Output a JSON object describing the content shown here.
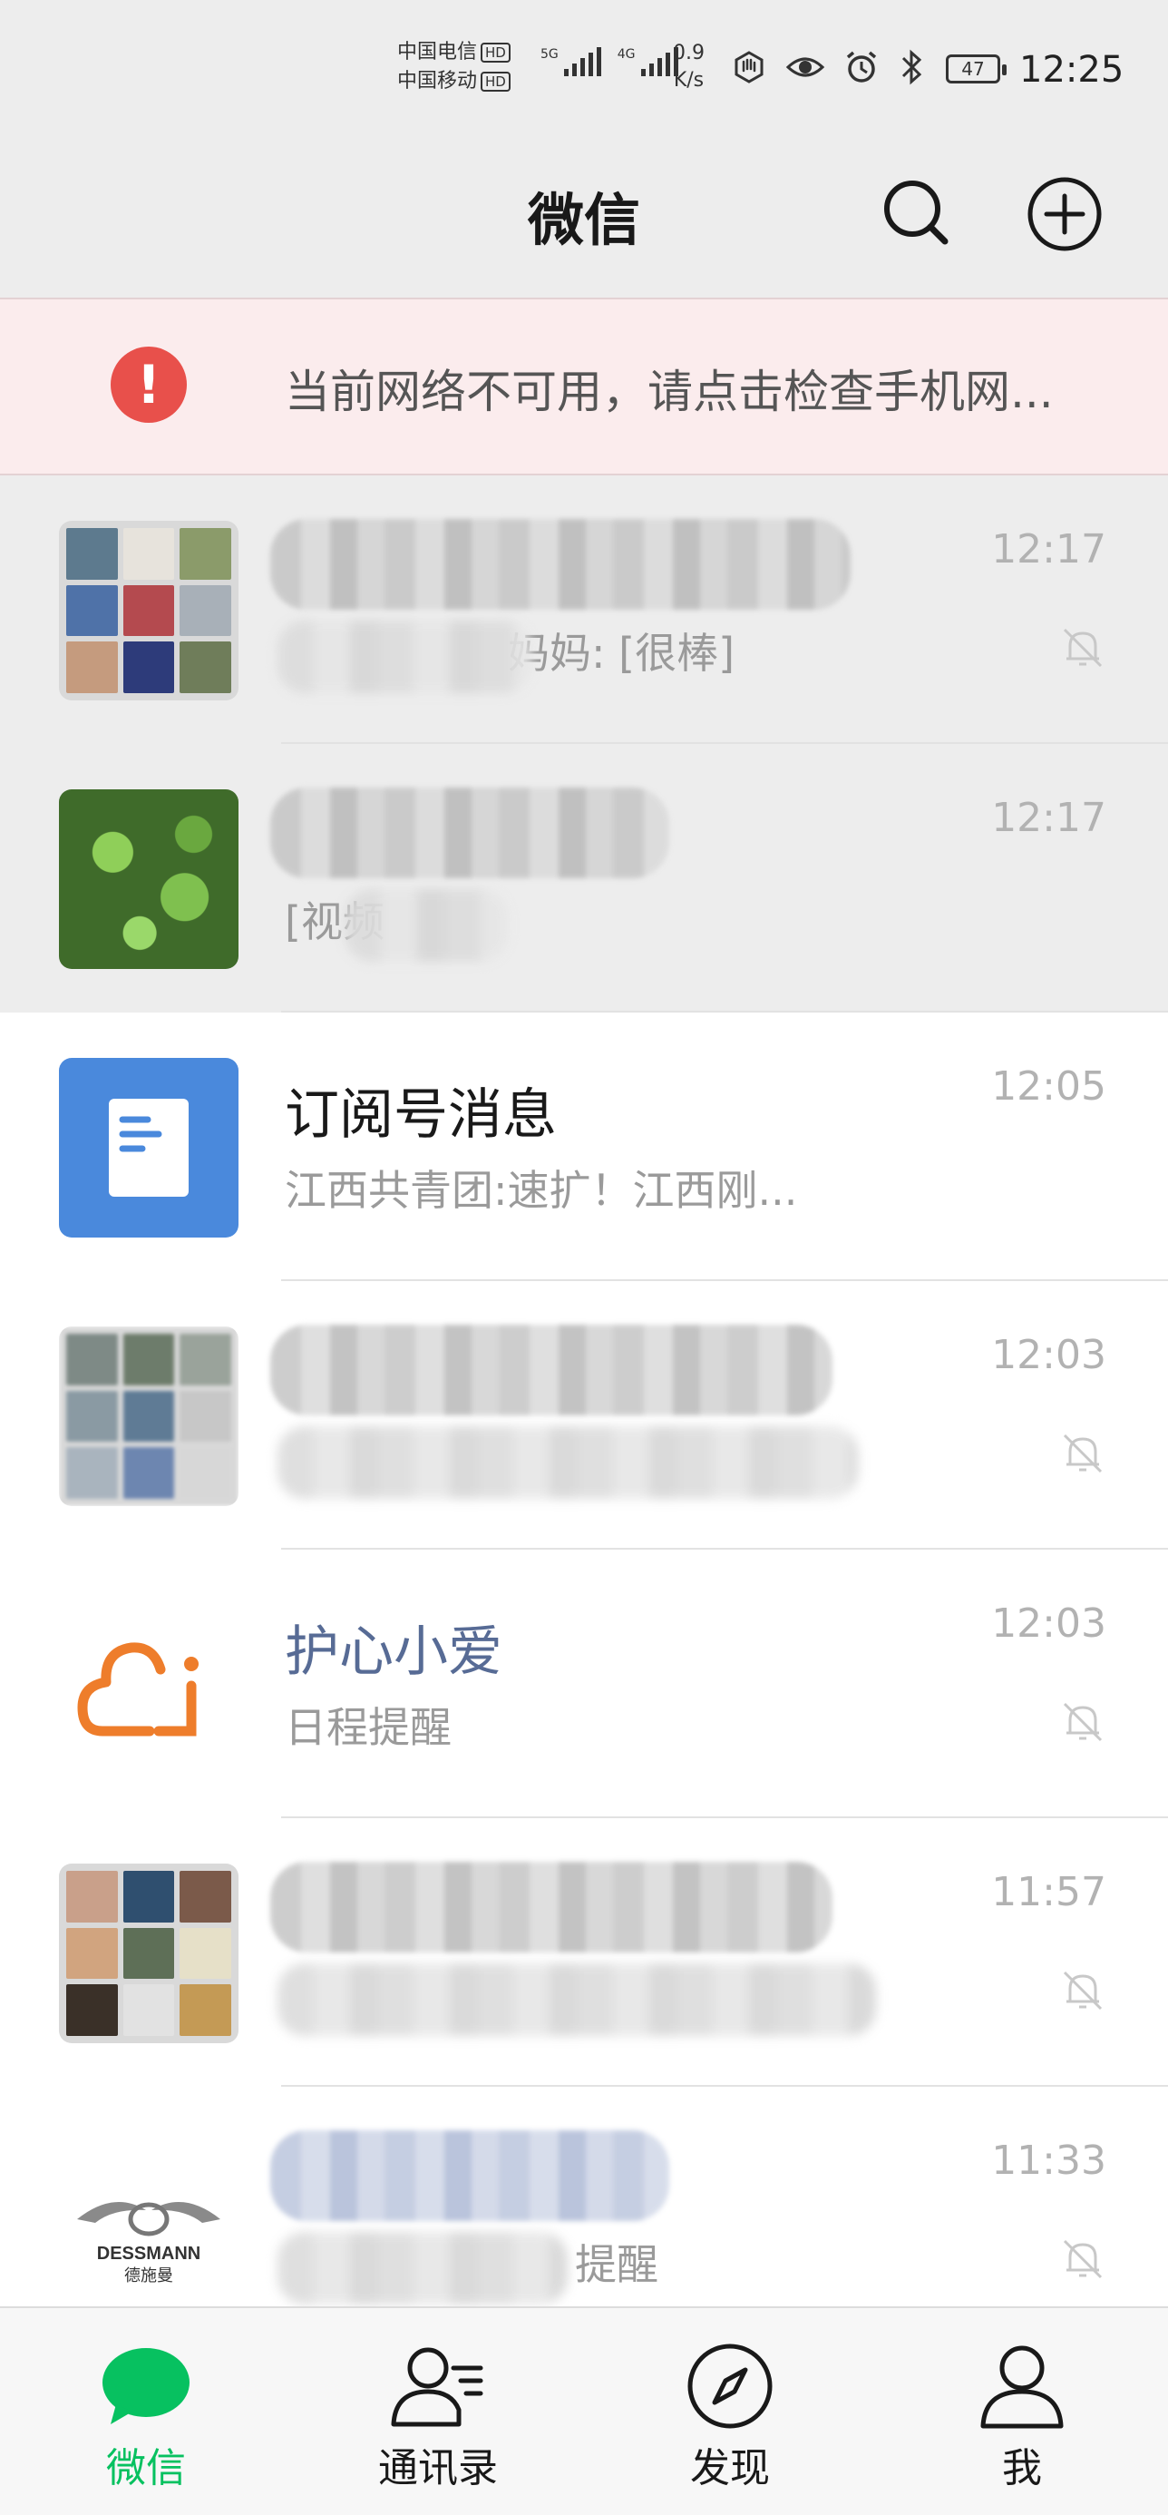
{
  "status_bar": {
    "carrier1": "中国电信",
    "carrier2": "中国移动",
    "hd_badge": "HD",
    "net1_label": "5G",
    "net2_label": "4G",
    "speed_value": "0.9",
    "speed_unit": "K/s",
    "battery": "47",
    "time": "12:25"
  },
  "header": {
    "title": "微信",
    "search_icon": "search-icon",
    "add_icon": "plus-circle-icon"
  },
  "banner": {
    "icon": "!",
    "text": "当前网络不可用，请点击检查手机网..."
  },
  "chats": [
    {
      "time": "12:17",
      "preview_fragment": "妈妈: [很棒]",
      "muted": true
    },
    {
      "time": "12:17",
      "preview_fragment": "[视频",
      "muted": false
    },
    {
      "name": "订阅号消息",
      "preview": "江西共青团:速扩！江西刚...",
      "time": "12:05",
      "muted": false
    },
    {
      "time": "12:03",
      "muted": true
    },
    {
      "name": "护心小爱",
      "preview": "日程提醒",
      "time": "12:03",
      "muted": true
    },
    {
      "time": "11:57",
      "muted": true
    },
    {
      "time": "11:33",
      "preview_fragment": "提醒",
      "muted": true
    }
  ],
  "avatar_dessmann": {
    "brand": "DESSMANN",
    "brand_cn": "德施曼"
  },
  "tabs": [
    {
      "label": "微信",
      "icon": "chat-bubble-icon",
      "active": true
    },
    {
      "label": "通讯录",
      "icon": "contacts-icon",
      "active": false
    },
    {
      "label": "发现",
      "icon": "compass-icon",
      "active": false
    },
    {
      "label": "我",
      "icon": "person-icon",
      "active": false
    }
  ],
  "colors": {
    "brand_green": "#07c160",
    "alert_red": "#e8504b",
    "official_blue": "#576b95",
    "header_bg": "#ededed"
  }
}
